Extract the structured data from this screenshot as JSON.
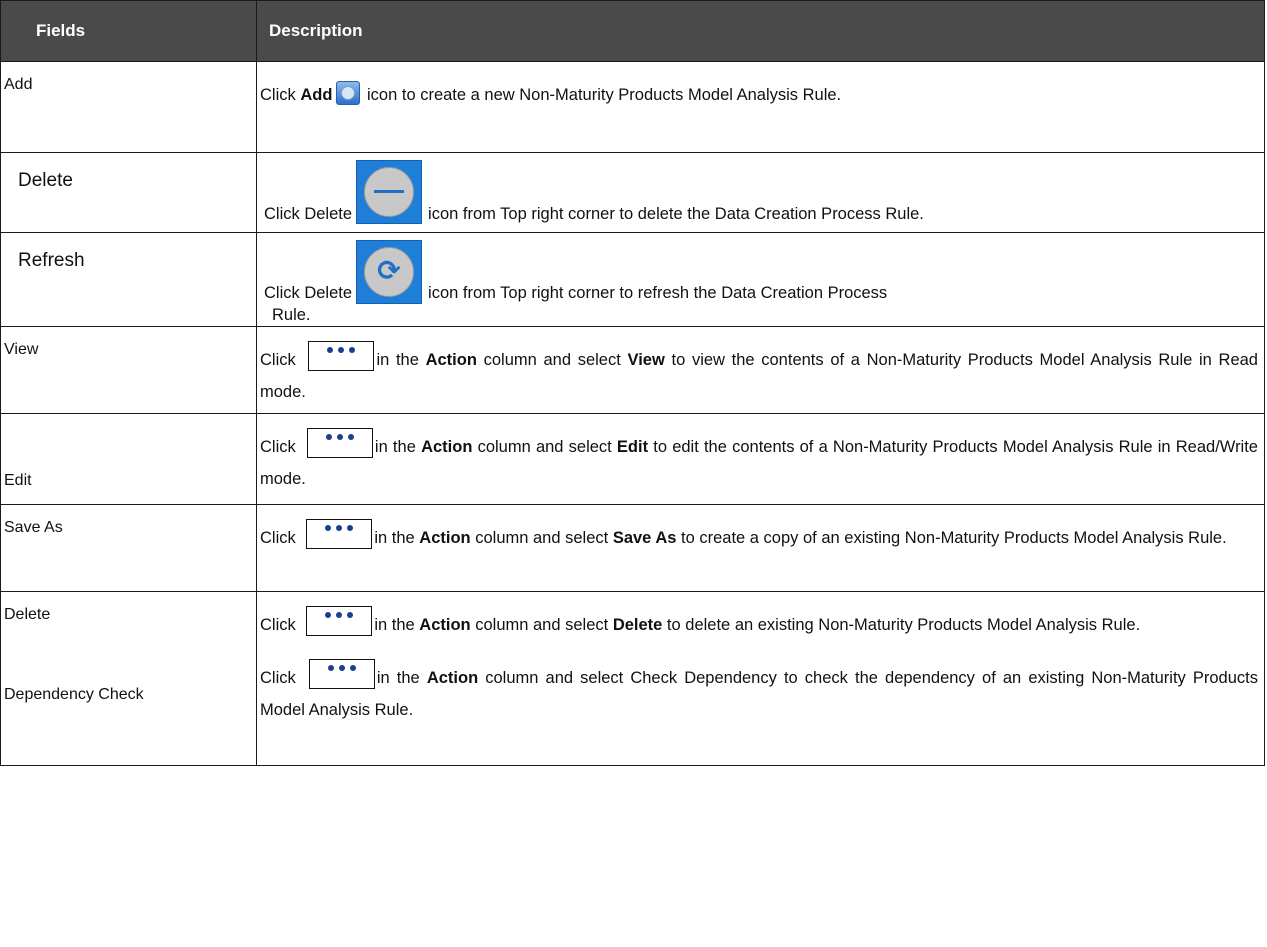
{
  "header": {
    "fields": "Fields",
    "description": "Description"
  },
  "rows": [
    {
      "field": "Add",
      "pre": "Click ",
      "bold": "Add",
      "icon": "add-icon",
      "post": " icon to create a new Non-Maturity Products Model Analysis Rule."
    },
    {
      "field": "Delete",
      "pre": "Click Delete",
      "icon": "minus-circle-icon",
      "post": "icon from Top right corner to delete the Data Creation Process Rule."
    },
    {
      "field": "Refresh",
      "pre": "Click Delete",
      "icon": "refresh-icon",
      "post": "icon from Top right corner to refresh the Data Creation Process",
      "post2": "Rule."
    },
    {
      "field": "View",
      "pre": "Click ",
      "icon": "ellipsis-icon",
      "mid": "in the ",
      "b1": "Action",
      "mid2": " column and select ",
      "b2": "View",
      "post": " to view the contents of a Non-Maturity Products Model Analysis Rule in Read mode."
    },
    {
      "field": "Edit",
      "pre": "Click ",
      "icon": "ellipsis-icon",
      "mid": "in the ",
      "b1": "Action",
      "mid2": " column and select ",
      "b2": "Edit",
      "post": " to edit the contents of a Non-Maturity Products Model Analysis Rule in Read/Write mode."
    },
    {
      "field": "Save As",
      "pre": "Click ",
      "icon": "ellipsis-icon",
      "mid": "in the ",
      "b1": "Action",
      "mid2": " column and select ",
      "b2": "Save As",
      "post": " to create a copy of an existing Non-Maturity Products Model Analysis Rule."
    },
    {
      "field": "Delete",
      "field2": "Dependency Check",
      "pre": "Click ",
      "icon": "ellipsis-icon",
      "mid": "in the ",
      "b1": "Action",
      "mid2": " column and select ",
      "b2": "Delete",
      "post": " to delete an existing Non-Maturity Products Model Analysis Rule.",
      "pre_b": "Click ",
      "mid_b": "in the ",
      "b1_b": "Action",
      "post_b": " column and select Check Dependency to check the dependency of an existing Non-Maturity Products Model Analysis Rule."
    }
  ],
  "colors": {
    "header_bg": "#4a4a4a",
    "icon_blue": "#1f7fd8"
  }
}
